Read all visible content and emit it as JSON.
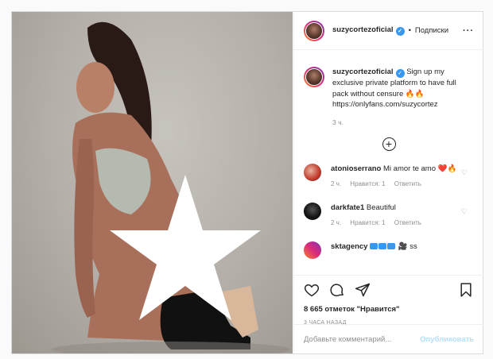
{
  "post": {
    "username": "suzycortezoficial",
    "follow_label": "Подписки",
    "separator": "•",
    "more_label": "···",
    "caption_username": "suzycortezoficial",
    "caption_text": "Sign up my exclusive private platform to have full pack without censure 🔥🔥 https://onlyfans.com/suzycortez",
    "time": "3 ч.",
    "load_more": "+"
  },
  "comments": [
    {
      "username": "atonioserrano",
      "text": "Mi amor te amo ❤️🔥",
      "time": "2 ч.",
      "likes": "Нравится: 1",
      "reply": "Ответить",
      "avatar_color": "#c0392b"
    },
    {
      "username": "darkfate1",
      "text": "Beautiful",
      "time": "2 ч.",
      "likes": "Нравится: 1",
      "reply": "Ответить",
      "avatar_color": "#1a1a1a"
    },
    {
      "username": "sktagency",
      "text": "🎥 ss",
      "avatar_color": "#dd2a7b"
    }
  ],
  "actions": {
    "likes": "8 665 отметок \"Нравится\"",
    "ago": "3 ЧАСА НАЗАД"
  },
  "add_comment": {
    "placeholder": "Добавьте комментарий...",
    "publish": "Опубликовать"
  },
  "icons": [
    "heart-icon",
    "comment-icon",
    "share-icon",
    "bookmark-icon",
    "verified-badge-icon",
    "plus-circle-icon",
    "star-censor-shape"
  ],
  "colors": {
    "accent": "#3897f0",
    "publish_disabled": "#b2dffc",
    "muted": "#8e8e8e"
  }
}
